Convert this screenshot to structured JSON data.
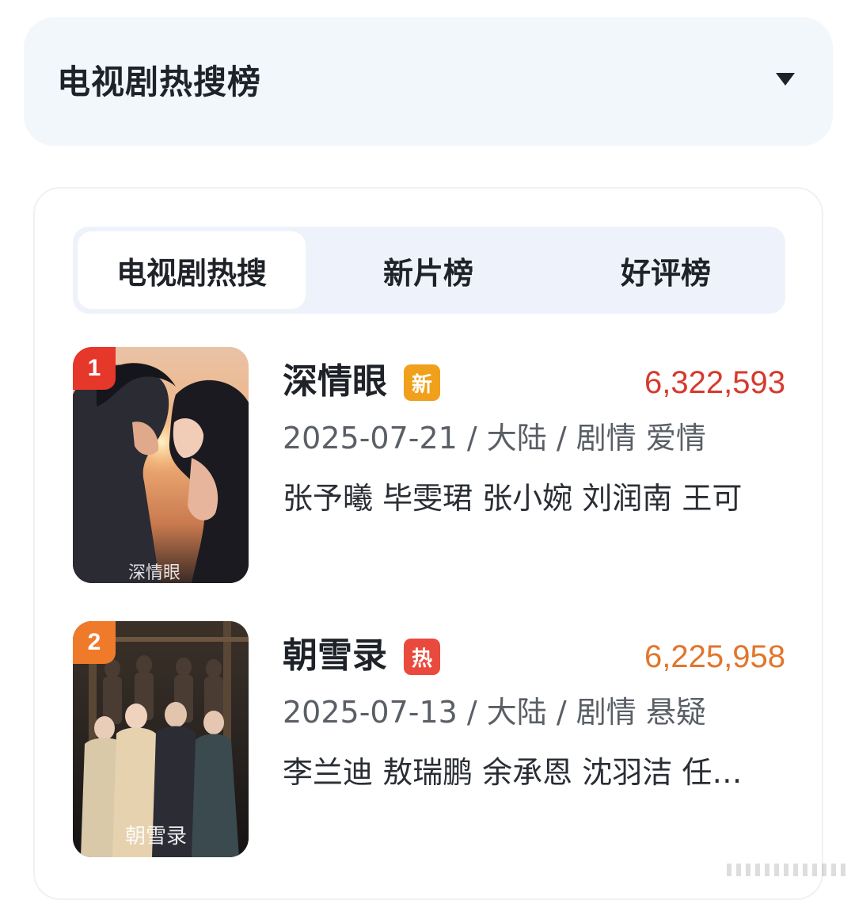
{
  "header": {
    "title": "电视剧热搜榜",
    "caret_icon": "caret-down-icon"
  },
  "tabs": [
    {
      "label": "电视剧热搜",
      "active": true
    },
    {
      "label": "新片榜",
      "active": false
    },
    {
      "label": "好评榜",
      "active": false
    }
  ],
  "items": [
    {
      "rank": "1",
      "rank_color": "#e5372a",
      "title": "深情眼",
      "tag": "新",
      "tag_color": "#f0a01a",
      "score": "6,322,593",
      "score_color": "#d63a2e",
      "meta": "2025-07-21 / 大陆 / 剧情 爱情",
      "cast": "张予曦 毕雯珺 张小婉 刘润南 王可",
      "poster_icon": "poster-romance-image"
    },
    {
      "rank": "2",
      "rank_color": "#ef7a2a",
      "title": "朝雪录",
      "tag": "热",
      "tag_color": "#ea4a3e",
      "score": "6,225,958",
      "score_color": "#e2752c",
      "meta": "2025-07-13 / 大陆 / 剧情 悬疑",
      "cast": "李兰迪 敖瑞鹏 余承恩 沈羽洁 任…",
      "poster_icon": "poster-costume-drama-image"
    }
  ]
}
